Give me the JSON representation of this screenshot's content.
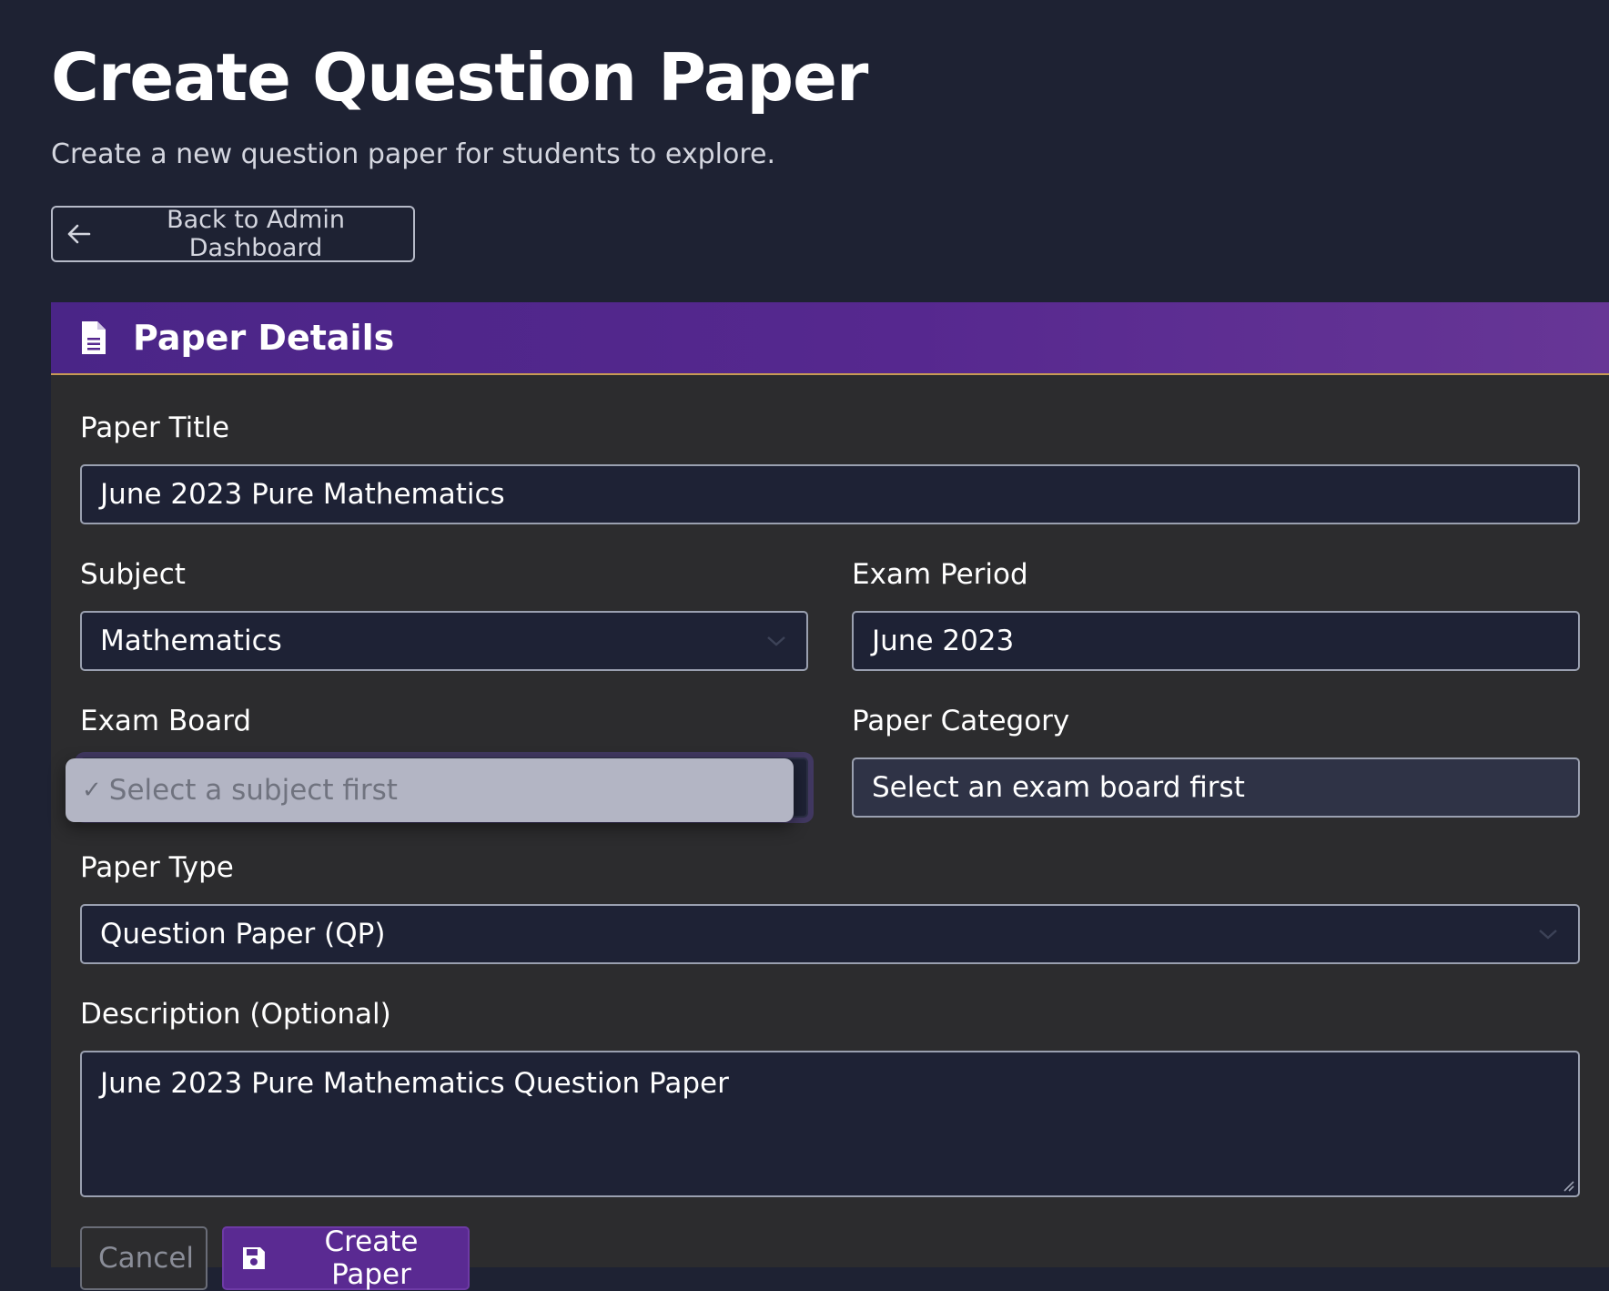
{
  "header": {
    "title": "Create Question Paper",
    "subtitle": "Create a new question paper for students to explore.",
    "back_button_label": "Back to Admin Dashboard"
  },
  "card": {
    "title": "Paper Details",
    "icon": "file-text-icon"
  },
  "form": {
    "paper_title": {
      "label": "Paper Title",
      "value": "June 2023 Pure Mathematics"
    },
    "subject": {
      "label": "Subject",
      "value": "Mathematics"
    },
    "exam_period": {
      "label": "Exam Period",
      "value": "June 2023"
    },
    "exam_board": {
      "label": "Exam Board",
      "option_selected": "Select a subject first"
    },
    "paper_category": {
      "label": "Paper Category",
      "value": "Select an exam board first"
    },
    "paper_type": {
      "label": "Paper Type",
      "value": "Question Paper (QP)"
    },
    "description": {
      "label": "Description (Optional)",
      "value": "June 2023 Pure Mathematics Question Paper"
    }
  },
  "actions": {
    "cancel_label": "Cancel",
    "create_label": "Create Paper"
  },
  "colors": {
    "page_background": "#1e2233",
    "card_background": "#2c2c2e",
    "header_gradient_start": "#4a2587",
    "header_gradient_end": "#673696",
    "header_border": "#c89a55",
    "primary_button": "#5a2a92"
  }
}
